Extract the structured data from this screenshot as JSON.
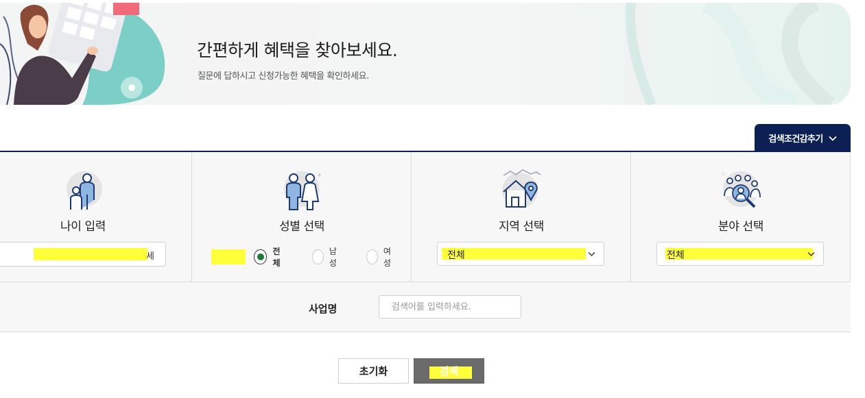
{
  "banner": {
    "title": "간편하게 혜택을 찾아보세요.",
    "subtitle": "질문에 답하시고 신청가능한 혜택을 확인하세요."
  },
  "toggle": {
    "label": "검색조건감추기",
    "icon": "chevron-down-icon"
  },
  "filters": {
    "age": {
      "label": "나이 입력",
      "unit": "세",
      "icon": "family-icon",
      "value": ""
    },
    "gender": {
      "label": "성별 선택",
      "icon": "man-woman-icon",
      "options": [
        "전체",
        "남성",
        "여성"
      ],
      "selected": "전체"
    },
    "region": {
      "label": "지역 선택",
      "icon": "house-location-icon",
      "value": "전체"
    },
    "field": {
      "label": "분야 선택",
      "icon": "people-search-icon",
      "value": "전체"
    }
  },
  "business": {
    "label": "사업명",
    "placeholder": "검색어를 입력하세요."
  },
  "buttons": {
    "reset": "초기화",
    "search": "검색"
  },
  "colors": {
    "navy": "#0c2054",
    "highlight": "#ffff3a",
    "radio_checked": "#1e7b37",
    "search_button": "#6b6b6b"
  }
}
